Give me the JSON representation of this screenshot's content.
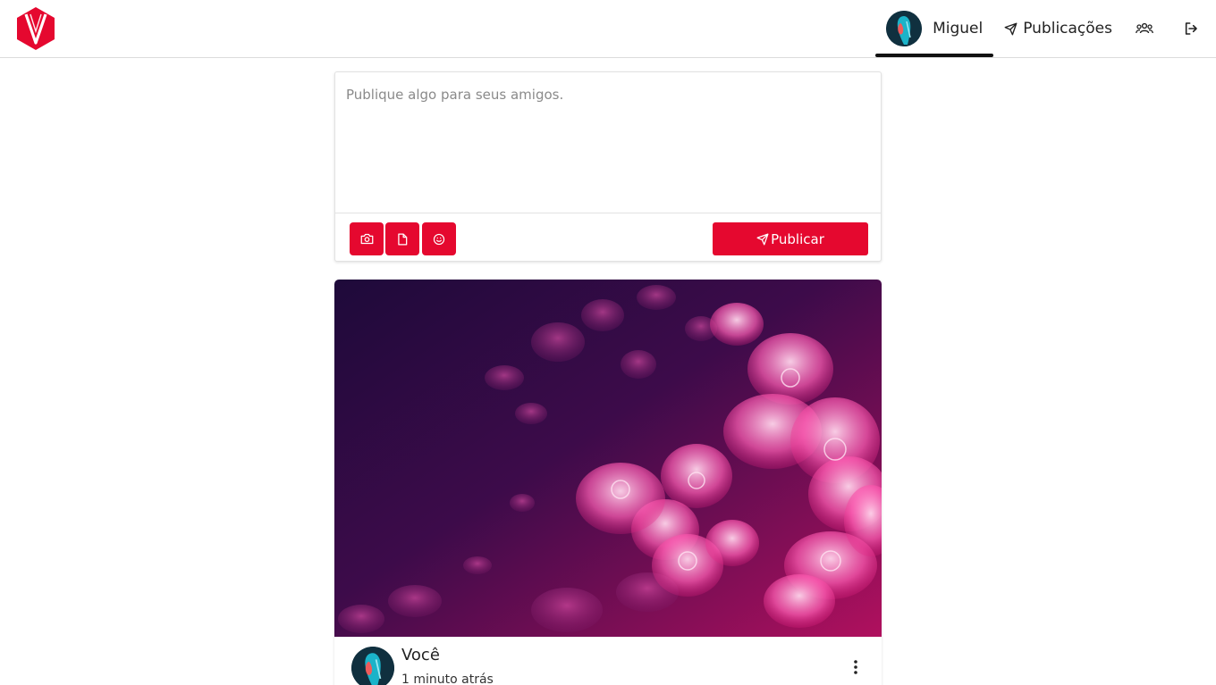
{
  "brand": {
    "logo_icon": "v-hexagon-logo-icon",
    "accent_color": "#e5082f"
  },
  "nav": {
    "profile_name": "Miguel",
    "profile_avatar_icon": "avatar-icon",
    "publications_label": "Publicações",
    "publications_icon": "send-icon",
    "friends_icon": "users-icon",
    "logout_icon": "logout-icon"
  },
  "composer": {
    "placeholder": "Publique algo para seus amigos.",
    "value": "",
    "tools": [
      {
        "icon": "camera-icon"
      },
      {
        "icon": "file-icon"
      },
      {
        "icon": "smile-icon"
      }
    ],
    "publish_label": "Publicar"
  },
  "post": {
    "image_icon": "jellyfish-image",
    "author": "Você",
    "time": "1 minuto atrás",
    "menu_icon": "more-vertical-icon"
  }
}
